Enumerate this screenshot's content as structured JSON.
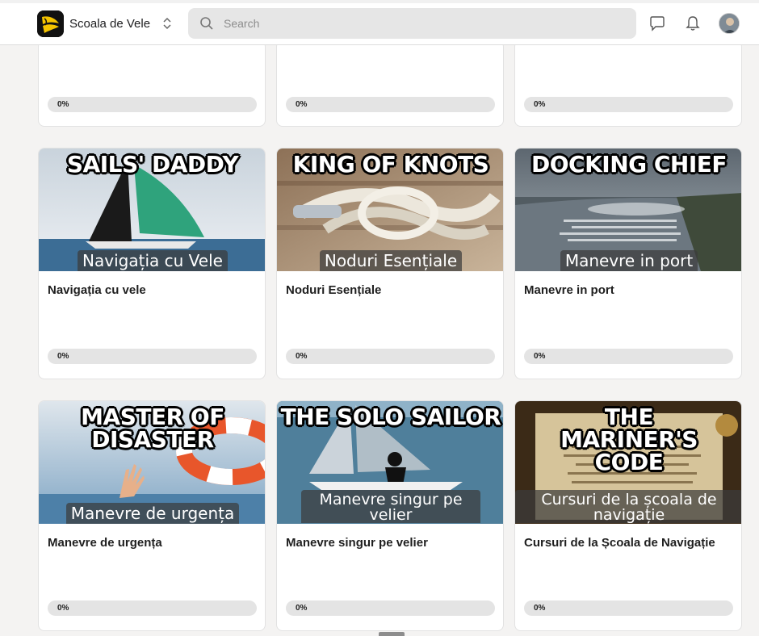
{
  "app": {
    "name": "Scoala de Vele",
    "search_placeholder": "Search",
    "icons": {
      "switcher": "chevron-up-down-icon",
      "search": "search-icon",
      "chat": "chat-icon",
      "notifications": "bell-icon",
      "avatar": "avatar"
    }
  },
  "top_row": [
    {
      "progress": "0%",
      "progress_value": 0
    },
    {
      "progress": "0%",
      "progress_value": 0
    },
    {
      "progress": "0%",
      "progress_value": 0
    }
  ],
  "courses": [
    {
      "thumb_title": "SAILS' DADDY",
      "thumb_caption": "Navigația cu Vele",
      "title": "Navigația cu vele",
      "progress": "0%",
      "progress_value": 0
    },
    {
      "thumb_title": "KING OF KNOTS",
      "thumb_caption": "Noduri Esențiale",
      "title": "Noduri Esențiale",
      "progress": "0%",
      "progress_value": 0
    },
    {
      "thumb_title": "DOCKING CHIEF",
      "thumb_caption": "Manevre in port",
      "title": "Manevre in port",
      "progress": "0%",
      "progress_value": 0
    },
    {
      "thumb_title": "MASTER OF DISASTER",
      "thumb_caption": "Manevre de urgența",
      "title": "Manevre de urgența",
      "progress": "0%",
      "progress_value": 0
    },
    {
      "thumb_title": "THE SOLO SAILOR",
      "thumb_caption": "Manevre singur pe velier",
      "title": "Manevre singur pe velier",
      "progress": "0%",
      "progress_value": 0
    },
    {
      "thumb_title": "THE MARINER'S CODE",
      "thumb_caption": "Cursuri de la școala de navigație",
      "title": "Cursuri de la Școala de Navigație",
      "progress": "0%",
      "progress_value": 0
    }
  ],
  "colors": {
    "background": "#f4f3f2",
    "card": "#ffffff",
    "progress_track": "#e4e4e4",
    "logo_accent": "#f5c400"
  }
}
